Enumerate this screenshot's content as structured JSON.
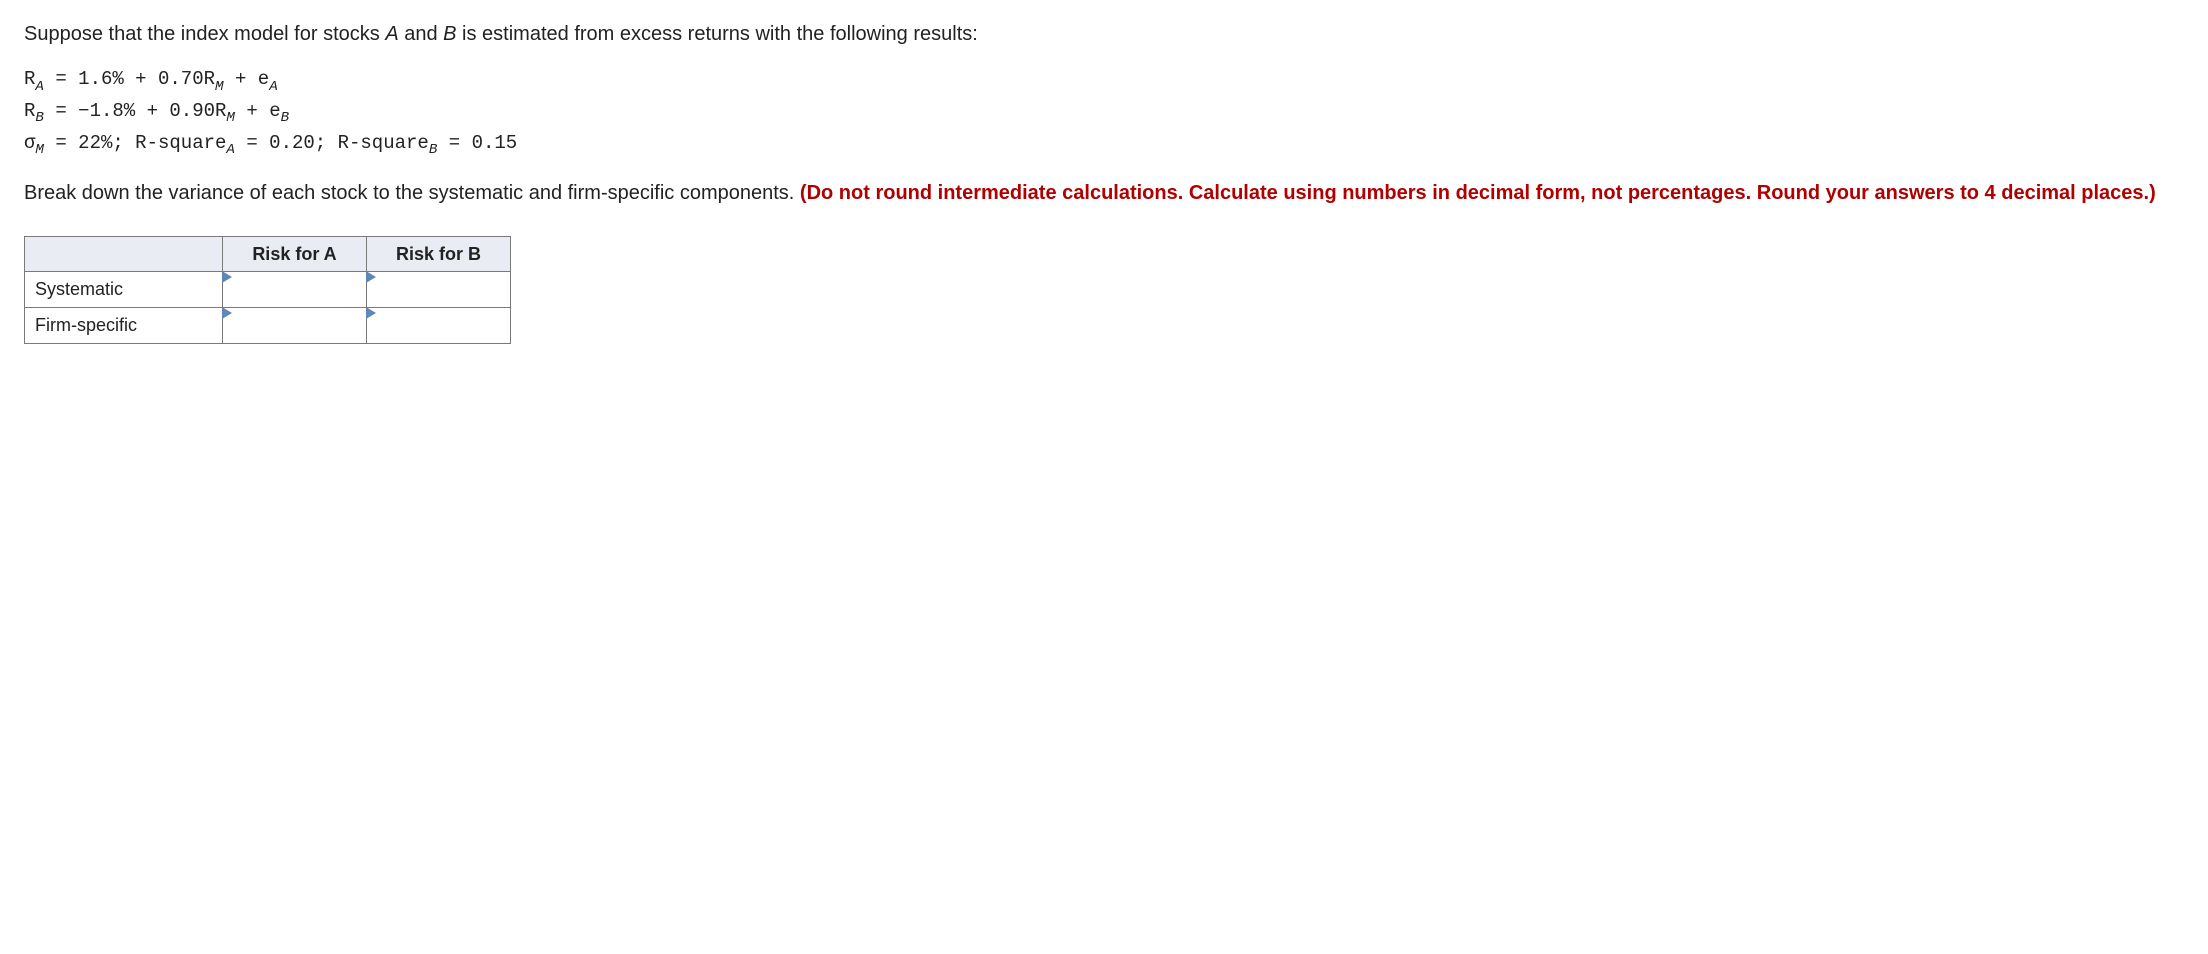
{
  "intro": {
    "pre": "Suppose that the index model for stocks ",
    "stockA": "A",
    "mid": " and ",
    "stockB": "B",
    "post": " is estimated from excess returns with the following results:"
  },
  "eq": {
    "ra_pre": "R",
    "ra_sub": "A",
    "ra_eq": " = 1.6% + 0.70",
    "rm1_pre": "R",
    "rm1_sub": "M",
    "ra_plus": " + ",
    "ea_pre": "e",
    "ea_sub": "A",
    "rb_pre": "R",
    "rb_sub": "B",
    "rb_eq": " = −1.8% + 0.90",
    "rm2_pre": "R",
    "rm2_sub": "M",
    "rb_plus": " + ",
    "eb_pre": "e",
    "eb_sub": "B",
    "sig_pre": "σ",
    "sig_sub": "M",
    "sig_eq": " = 22%;  R-square",
    "rsqA_sub": "A",
    "rsqA_val": " = 0.20;  R-square",
    "rsqB_sub": "B",
    "rsqB_val": " = 0.15"
  },
  "instr": {
    "plain": "Break down the variance of each stock to the systematic and firm-specific components. ",
    "red": "(Do not round intermediate calculations. Calculate using numbers in decimal form, not percentages. Round your answers to 4 decimal places.)"
  },
  "table": {
    "colA": "Risk for A",
    "colB": "Risk for B",
    "row1": "Systematic",
    "row2": "Firm-specific",
    "cells": {
      "sysA": "",
      "sysB": "",
      "firmA": "",
      "firmB": ""
    }
  }
}
